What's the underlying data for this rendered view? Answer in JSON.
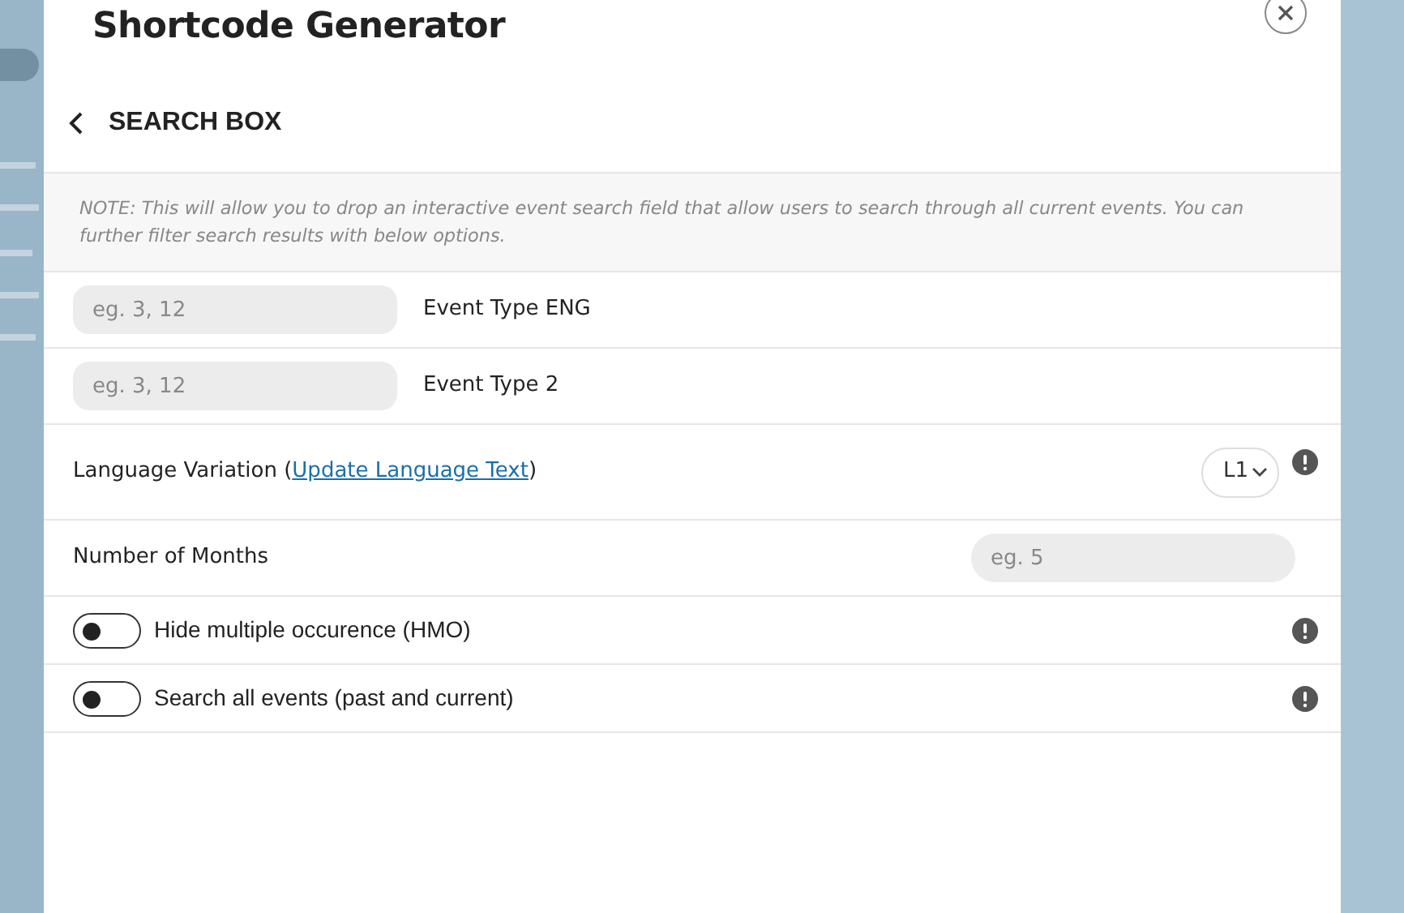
{
  "modal": {
    "title": "Shortcode Generator",
    "section": "SEARCH BOX",
    "note": "NOTE: This will allow you to drop an interactive event search field that allow users to search through all current events. You can further filter search results with below options."
  },
  "options": [
    {
      "kind": "text-field",
      "placeholder": "eg. 3, 12",
      "label": "Event Type ENG"
    },
    {
      "kind": "text-field",
      "placeholder": "eg. 3, 12",
      "label": "Event Type 2"
    },
    {
      "kind": "select",
      "label": "Language Variation (",
      "link": "Update Language Text",
      "label_end": ")",
      "value": "L1",
      "info": true
    },
    {
      "kind": "number",
      "label": "Number of Months",
      "placeholder": "eg. 5"
    },
    {
      "kind": "toggle",
      "label": "Hide multiple occurence (HMO)",
      "on": false,
      "info": true
    },
    {
      "kind": "toggle",
      "label": "Search all events (past and current)",
      "on": false,
      "info": true
    }
  ]
}
